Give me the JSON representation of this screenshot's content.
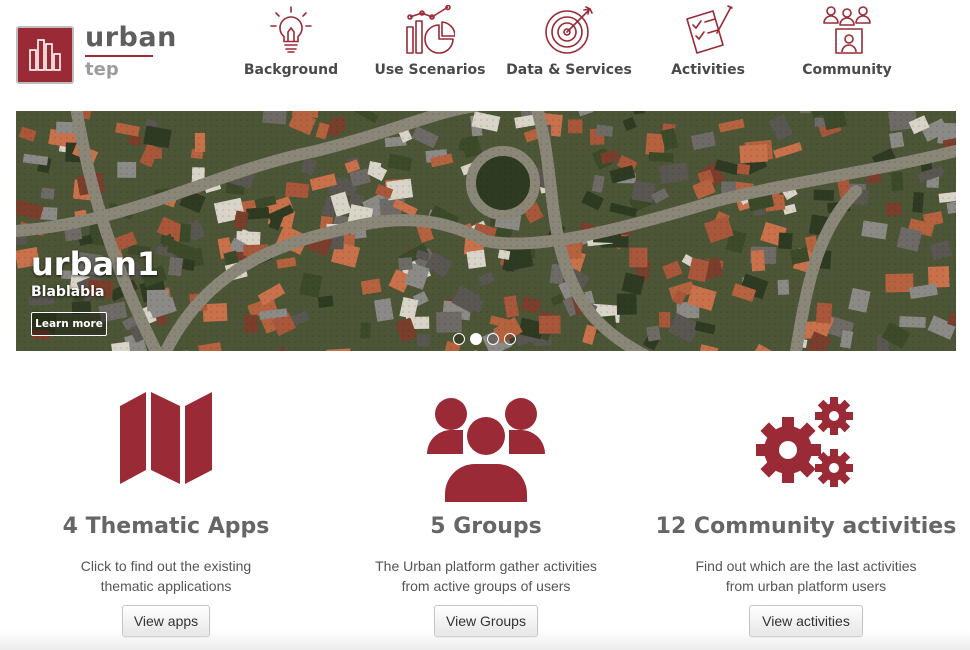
{
  "colors": {
    "brand": "#9a2a36",
    "nav_text": "#4a4a4a",
    "heading": "#666666"
  },
  "logo": {
    "word": "urban",
    "sub": "tep"
  },
  "nav": [
    {
      "label": "Background",
      "icon": "lightbulb-icon"
    },
    {
      "label": "Use Scenarios",
      "icon": "chart-icon"
    },
    {
      "label": "Data & Services",
      "icon": "target-icon"
    },
    {
      "label": "Activities",
      "icon": "checklist-icon"
    },
    {
      "label": "Community",
      "icon": "people-icon"
    }
  ],
  "carousel": {
    "title": "urban1",
    "subtitle": "Blablabla",
    "button": "Learn more",
    "slides": 4,
    "active_slide": 2
  },
  "features": [
    {
      "icon": "map-icon",
      "title": "4 Thematic Apps",
      "desc": [
        "Click to find out the existing",
        "thematic applications"
      ],
      "button": "View apps"
    },
    {
      "icon": "group-icon",
      "title": "5 Groups",
      "desc": [
        "The Urban platform gather activities",
        "from active groups of users"
      ],
      "button": "View Groups"
    },
    {
      "icon": "gears-icon",
      "title": "12 Community activities",
      "desc": [
        "Find out which are the last activities",
        "from urban platform users"
      ],
      "button": "View activities"
    }
  ]
}
